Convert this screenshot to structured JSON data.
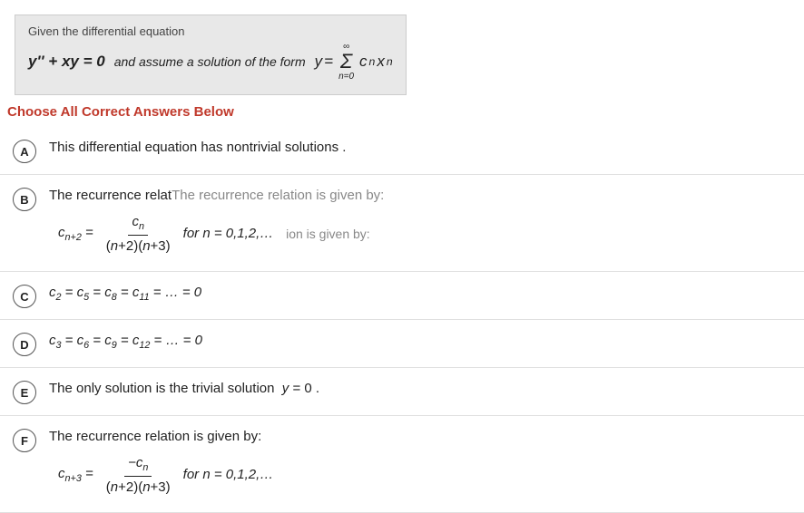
{
  "header": {
    "given_label": "Given the differential equation",
    "equation_left": "y'' + xy = 0",
    "equation_right_prefix": "and assume a solution of the form",
    "equation_right": "y = Σ cₙ xⁿ",
    "sum_bottom": "n=0",
    "sum_top": "∞"
  },
  "choose_label": "Choose All Correct Answers Below",
  "answers": [
    {
      "letter": "A",
      "text": "This differential equation has nontrivial solutions ."
    },
    {
      "letter": "B",
      "text": "The recurrence relation is given by:",
      "formula": "c_{n+2} = c_n / ((n+2)(n+3)) for n=0,1,2,... ion is given by:"
    },
    {
      "letter": "C",
      "text": "c₂ = c₅ = c₈ = c₁₁ = ... = 0"
    },
    {
      "letter": "D",
      "text": "c₃ = c₆ = c₉ = c₁₂ = ... = 0"
    },
    {
      "letter": "E",
      "text": "The only solution is the trivial solution  y = 0 ."
    },
    {
      "letter": "F",
      "text": "The recurrence relation is given by:",
      "formula": "c_{n+3} = -c_n / ((n+2)(n+3)) for n=0,1,2,..."
    }
  ]
}
